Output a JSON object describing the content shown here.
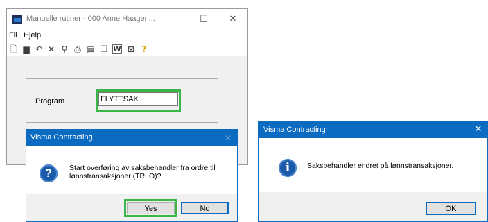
{
  "main_window": {
    "title": "Manuelle rutiner - 000 Anne Haagen...",
    "caption": {
      "minimize": "—",
      "maximize": "☐",
      "close": "✕"
    },
    "menu": [
      "Fil",
      "Hjelp"
    ],
    "toolbar": {
      "icons": [
        {
          "name": "new-doc-icon",
          "glyph": "🗋"
        },
        {
          "name": "save-icon",
          "glyph": "▆"
        },
        {
          "name": "undo-icon",
          "glyph": "↶"
        },
        {
          "name": "delete-icon",
          "glyph": "✕"
        },
        {
          "name": "find-icon",
          "glyph": "⚲"
        },
        {
          "name": "print-icon",
          "glyph": "⎙"
        },
        {
          "name": "form-icon",
          "glyph": "▤"
        },
        {
          "name": "copy-icon",
          "glyph": "❐"
        },
        {
          "name": "word-export-icon",
          "glyph": "W"
        },
        {
          "name": "excel-export-icon",
          "glyph": "⊠"
        },
        {
          "name": "help-icon",
          "glyph": "?"
        }
      ]
    },
    "program": {
      "label": "Program",
      "value": "FLYTTSAK"
    },
    "highlight_color": "#3ab54a"
  },
  "confirm_dialog": {
    "title": "Visma Contracting",
    "close_glyph": "✕",
    "icon": "question-icon",
    "icon_glyph": "?",
    "message": "Start overføring av saksbehandler fra ordre til lønnstransaksjoner (TRLO)?",
    "yes_label": "Yes",
    "no_label": "No",
    "accent_color": "#0b6bc1"
  },
  "info_dialog": {
    "title": "Visma Contracting",
    "close_glyph": "✕",
    "icon": "info-icon",
    "icon_glyph": "i",
    "message": "Saksbehandler endret på lønnstransaksjoner.",
    "ok_label": "OK"
  }
}
